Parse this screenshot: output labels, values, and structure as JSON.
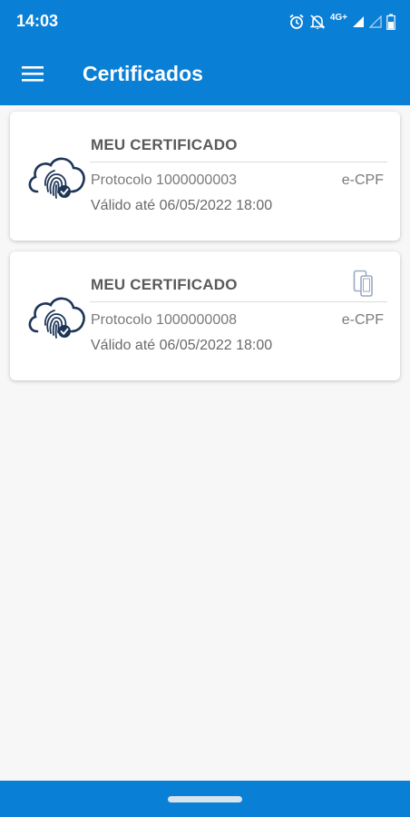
{
  "status_bar": {
    "time": "14:03",
    "network_label": "4G+",
    "icons": [
      "alarm-icon",
      "notifications-off-icon",
      "signal-icon",
      "battery-icon"
    ]
  },
  "app_bar": {
    "menu_icon": "hamburger-menu-icon",
    "title": "Certificados"
  },
  "certificates": [
    {
      "title": "MEU CERTIFICADO",
      "protocol": "Protocolo 1000000003",
      "type": "e-CPF",
      "validity": "Válido até 06/05/2022 18:00",
      "icon": "cloud-fingerprint-icon"
    },
    {
      "title": "MEU CERTIFICADO",
      "protocol": "Protocolo 1000000008",
      "type": "e-CPF",
      "validity": "Válido até 06/05/2022 18:00",
      "icon": "cloud-fingerprint-icon",
      "badge_icon": "devices-icon"
    }
  ],
  "colors": {
    "primary": "#0a7fd6",
    "background": "#f7f7f7",
    "card": "#ffffff",
    "icon_navy": "#1d3557"
  }
}
